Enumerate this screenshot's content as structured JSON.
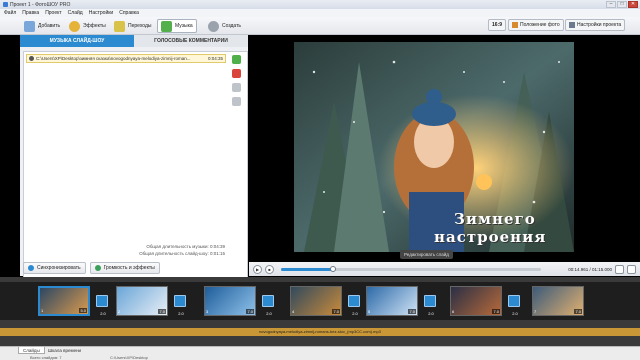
{
  "window": {
    "title": "Проект 1 - ФотоШОУ PRO",
    "buttons": [
      "–",
      "□",
      "✕"
    ]
  },
  "menu": [
    "Файл",
    "Правка",
    "Проект",
    "Слайд",
    "Настройки",
    "Справка"
  ],
  "toolbar": {
    "buttons": [
      {
        "label": "Добавить",
        "icon": "add-photo-icon"
      },
      {
        "label": "Эффекты",
        "icon": "effects-star-icon"
      },
      {
        "label": "Переходы",
        "icon": "transitions-icon"
      },
      {
        "label": "Музыка",
        "icon": "music-note-icon",
        "active": true
      },
      {
        "label": "Создать",
        "icon": "create-film-icon"
      }
    ],
    "aspect": "16:9",
    "photo_position": "Положение фото",
    "project_settings": "Настройки проекта"
  },
  "left_panel": {
    "tabs": [
      "МУЗЫКА СЛАЙД-ШОУ",
      "ГОЛОСОВЫЕ КОММЕНТАРИИ"
    ],
    "track": {
      "path": "C:\\Users\\XP\\Desktop\\зимняя сказка\\novogodnyaya-melodiya-zimnij-roman...",
      "time": "0:04:35"
    },
    "totals": [
      "Общая длительность музыки: 0:04:39",
      "Общая длительность слайд-шоу: 0:01:15"
    ],
    "buttons": {
      "sync": "Синхронизировать",
      "volume": "Громкость и эффекты"
    }
  },
  "preview": {
    "overlay_text_1": "Зимнего",
    "overlay_text_2": "настроения",
    "edit_slide": "Редактировать слайд",
    "timecode": "00:14.961 / 01:15.000",
    "progress": 0.2
  },
  "timeline": {
    "slides": [
      {
        "num": "1",
        "dur": "5.0"
      },
      {
        "num": "2",
        "dur": "7.0"
      },
      {
        "num": "3",
        "dur": "7.0"
      },
      {
        "num": "4",
        "dur": "7.0"
      },
      {
        "num": "5",
        "dur": "7.0"
      },
      {
        "num": "6",
        "dur": "7.0"
      },
      {
        "num": "7",
        "dur": "7.0"
      }
    ],
    "transitions": [
      "2.0",
      "2.0",
      "2.0",
      "2.0",
      "2.0",
      "2.0"
    ],
    "music_label": "novogodnyaya-melodiya-zimnij-romans-bez-slov_(mp3CC.com).mp3"
  },
  "statusbar": {
    "tabs": [
      "Слайды",
      "Шкала времени"
    ],
    "info": [
      "Всего слайдов: 7",
      "C:\\Users\\XP\\Desktop"
    ]
  }
}
